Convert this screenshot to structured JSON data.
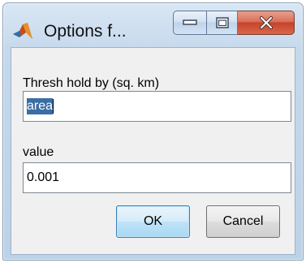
{
  "window": {
    "title": "Options f...",
    "icons": {
      "app": "matlab-icon",
      "minimize": "minimize-icon",
      "maximize": "maximize-icon",
      "close": "close-icon"
    }
  },
  "form": {
    "threshold_label": "Thresh hold by (sq. km)",
    "threshold_value": "area",
    "value_label": "value",
    "value_value": "0.001"
  },
  "buttons": {
    "ok": "OK",
    "cancel": "Cancel"
  },
  "colors": {
    "selection": "#3a6ea5",
    "close_button": "#c5442a",
    "default_button_border": "#3c7fb1"
  }
}
